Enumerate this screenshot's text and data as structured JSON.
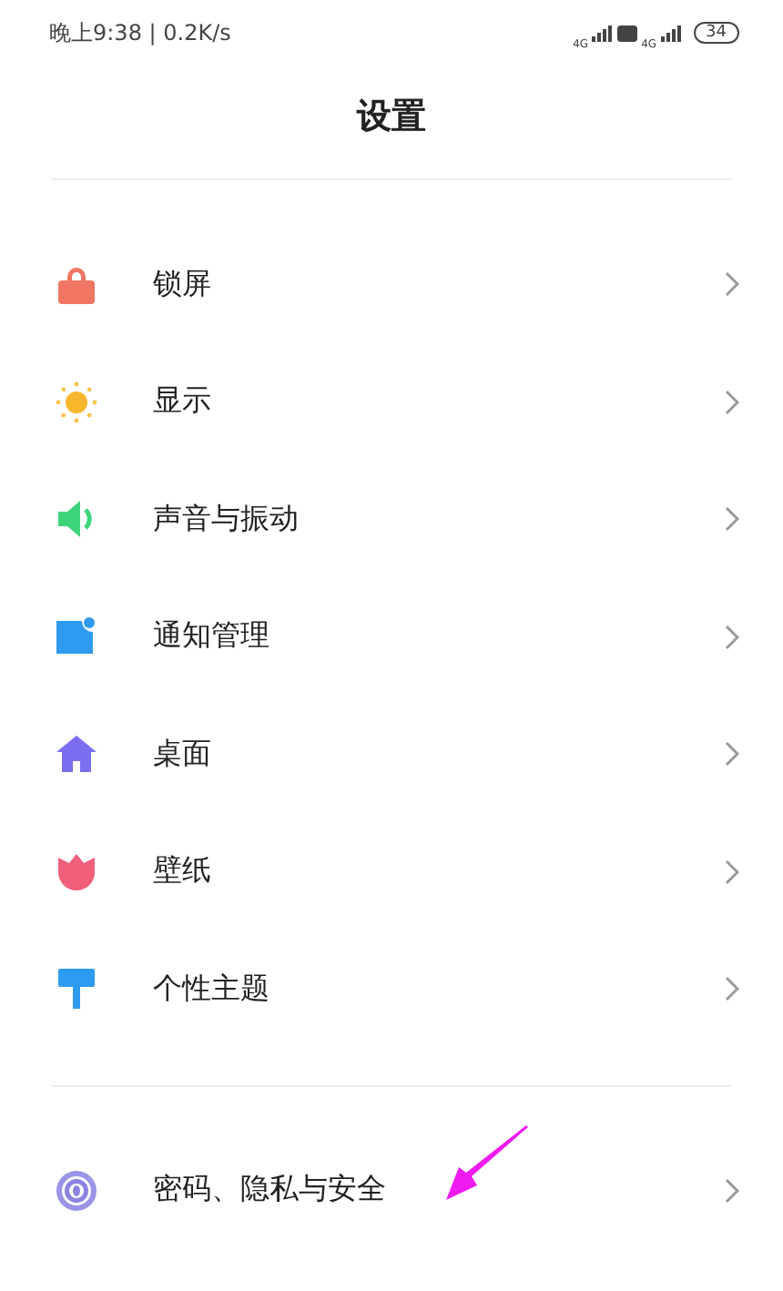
{
  "status_bar": {
    "time": "晚上9:38 | 0.2K/s",
    "network_1": "4G",
    "network_2": "4G",
    "battery": "34"
  },
  "title": "设置",
  "groups": [
    {
      "items": [
        {
          "label": "锁屏"
        },
        {
          "label": "显示"
        },
        {
          "label": "声音与振动"
        },
        {
          "label": "通知管理"
        },
        {
          "label": "桌面"
        },
        {
          "label": "壁纸"
        },
        {
          "label": "个性主题"
        }
      ]
    },
    {
      "items": [
        {
          "label": "密码、隐私与安全"
        }
      ]
    }
  ]
}
